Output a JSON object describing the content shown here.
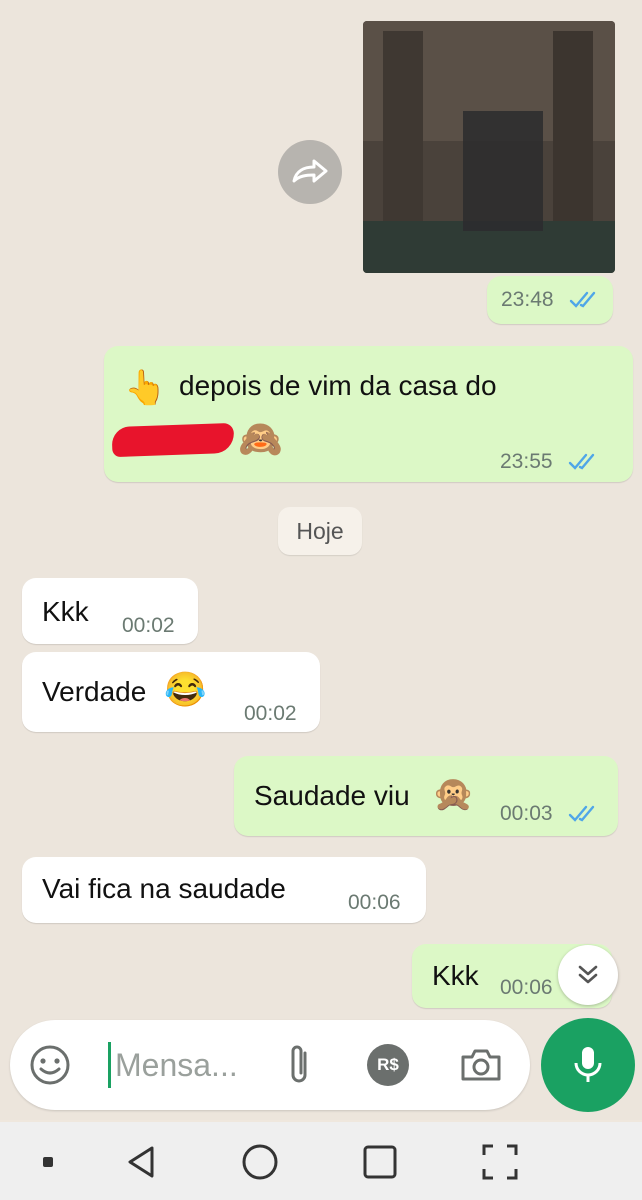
{
  "chat": {
    "forwarded_image": {
      "time": "23:48",
      "status": "read"
    },
    "outgoing_1": {
      "text": "depois de vim da casa do",
      "time": "23:55",
      "status": "read"
    },
    "date_divider": "Hoje",
    "incoming_1": {
      "text": "Kkk",
      "time": "00:02"
    },
    "incoming_2": {
      "text": "Verdade",
      "time": "00:02"
    },
    "outgoing_2": {
      "text": "Saudade viu",
      "time": "00:03",
      "status": "read"
    },
    "incoming_3": {
      "text": "Vai fica na saudade",
      "time": "00:06"
    },
    "outgoing_3": {
      "text": "Kkk",
      "time": "00:06",
      "status": "read"
    }
  },
  "composer": {
    "placeholder": "Mensa...",
    "value": "",
    "payment_label": "R$"
  },
  "colors": {
    "outgoing_bubble": "#dcf8c6",
    "incoming_bubble": "#ffffff",
    "accent": "#1aa162",
    "read_ticks": "#4fa6e8"
  },
  "icons": {
    "forward": "forward-icon",
    "scroll_down": "double-chevron-down-icon",
    "emoji": "emoji-icon",
    "attach": "paperclip-icon",
    "payment": "payment-icon",
    "camera": "camera-icon",
    "mic": "microphone-icon",
    "nav_back": "back-triangle-icon",
    "nav_home": "home-circle-icon",
    "nav_recents": "recents-square-icon",
    "nav_screenshot": "screenshot-frame-icon"
  }
}
